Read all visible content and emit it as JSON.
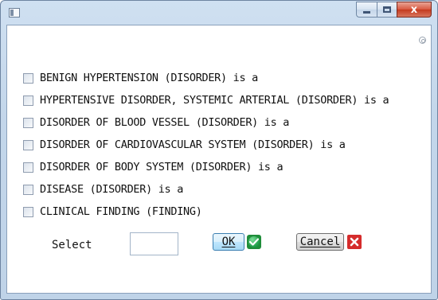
{
  "window": {
    "title": "",
    "icons": {
      "app": "window-icon",
      "minimize": "minimize-icon",
      "maximize": "maximize-icon",
      "close": "close-icon",
      "corner": "help-icon"
    },
    "close_glyph": "x"
  },
  "options": [
    {
      "label": "BENIGN HYPERTENSION (DISORDER) is a",
      "checked": false
    },
    {
      "label": "HYPERTENSIVE DISORDER, SYSTEMIC ARTERIAL (DISORDER) is a",
      "checked": false
    },
    {
      "label": "DISORDER OF BLOOD VESSEL (DISORDER) is a",
      "checked": false
    },
    {
      "label": "DISORDER OF CARDIOVASCULAR SYSTEM (DISORDER) is a",
      "checked": false
    },
    {
      "label": "DISORDER OF BODY SYSTEM (DISORDER) is a",
      "checked": false
    },
    {
      "label": "DISEASE (DISORDER) is a",
      "checked": false
    },
    {
      "label": "CLINICAL FINDING (FINDING)",
      "checked": false
    }
  ],
  "select": {
    "label": "Select",
    "value": ""
  },
  "buttons": {
    "ok_label": "OK",
    "cancel_label": "Cancel"
  },
  "colors": {
    "ok_icon": "#1f8d3a",
    "cancel_icon": "#d52c2c",
    "close_button": "#c43a1e"
  }
}
